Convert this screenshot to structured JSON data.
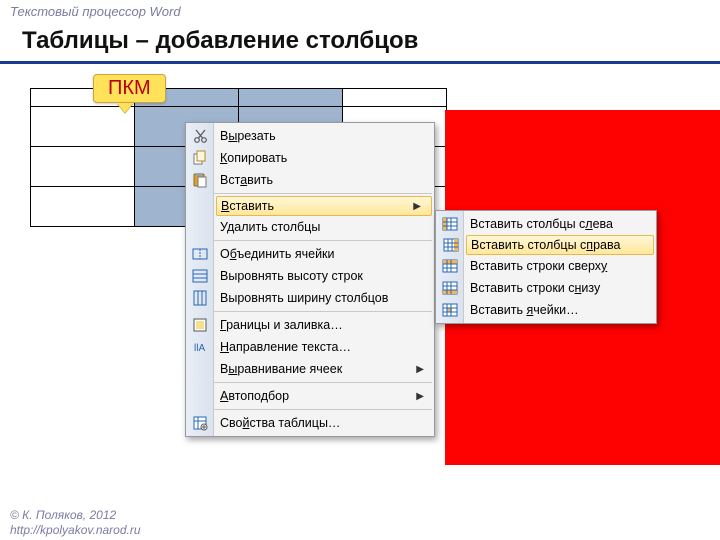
{
  "header": {
    "app": "Текстовый процессор Word"
  },
  "title": "Таблицы – добавление столбцов",
  "callout": {
    "pkm": "ПКМ"
  },
  "menu": {
    "cut": "Вырезать",
    "copy": "Копировать",
    "paste": "Вставить",
    "insert": "Вставить",
    "delcols": "Удалить столбцы",
    "merge": "Объединить ячейки",
    "evenrows": "Выровнять высоту строк",
    "evencols": "Выровнять ширину столбцов",
    "borders": "Границы и заливка…",
    "textdir": "Направление текста…",
    "align": "Выравнивание ячеек",
    "autofit": "Автоподбор",
    "props": "Свойства таблицы…"
  },
  "submenu": {
    "colsleft": "Вставить столбцы слева",
    "colsright": "Вставить столбцы справа",
    "rowsabove": "Вставить строки сверху",
    "rowsbelow": "Вставить строки снизу",
    "cells": "Вставить ячейки…"
  },
  "footer": {
    "l1": "© К. Поляков, 2012",
    "l2": "http://kpolyakov.narod.ru"
  }
}
